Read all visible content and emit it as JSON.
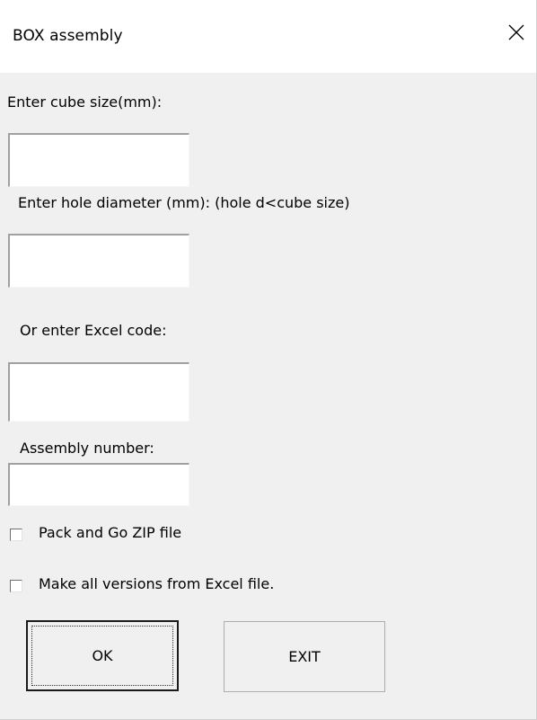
{
  "window": {
    "title": "BOX assembly"
  },
  "icons": {
    "close": "close-icon"
  },
  "form": {
    "cube_size_label": "Enter cube size(mm):",
    "cube_size_value": "",
    "hole_diameter_label": "Enter hole diameter (mm): (hole d<cube size)",
    "hole_diameter_value": "",
    "excel_code_label": "Or enter Excel code:",
    "excel_code_value": "",
    "assembly_number_label": "Assembly number:",
    "assembly_number_value": "",
    "pack_and_go_label": "Pack and Go ZIP file",
    "pack_and_go_checked": false,
    "make_all_versions_label": "Make all versions from Excel file.",
    "make_all_versions_checked": false
  },
  "buttons": {
    "ok_label": "OK",
    "exit_label": "EXIT"
  },
  "colors": {
    "titlebar": "#ffffff",
    "client": "#f0f0f0",
    "textbox": "#ffffff"
  }
}
